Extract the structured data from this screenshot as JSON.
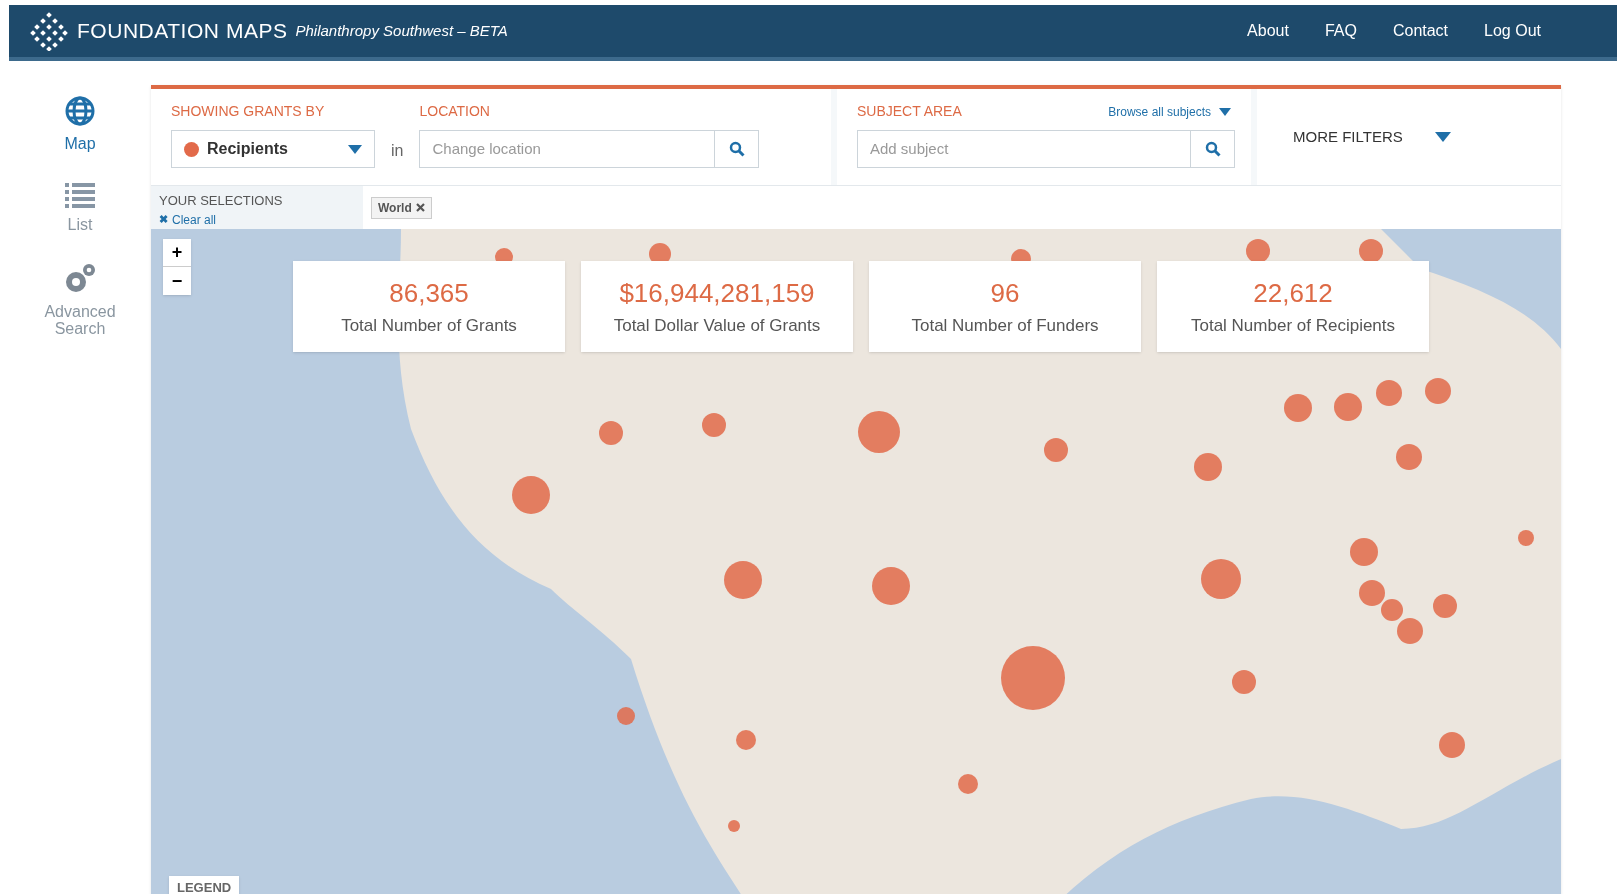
{
  "header": {
    "logo": "FOUNDATION MAPS",
    "subtitle": "Philanthropy Southwest – BETA",
    "nav": [
      "About",
      "FAQ",
      "Contact",
      "Log Out"
    ]
  },
  "sidebar": [
    {
      "kind": "map",
      "label": "Map",
      "selected": true
    },
    {
      "kind": "list",
      "label": "List",
      "selected": false
    },
    {
      "kind": "search",
      "label": "Advanced Search",
      "selected": false
    }
  ],
  "filters": {
    "showing_label": "SHOWING GRANTS BY",
    "showing_value": "Recipients",
    "connector": "in",
    "location_label": "LOCATION",
    "location_placeholder": "Change location",
    "subject_label": "SUBJECT AREA",
    "browse_link": "Browse all subjects",
    "subject_placeholder": "Add subject",
    "more_filters": "MORE FILTERS"
  },
  "selections": {
    "label": "YOUR SELECTIONS",
    "clear_icon": "✖",
    "clear": "Clear all",
    "tags": [
      "World"
    ]
  },
  "map": {
    "zoom_in": "+",
    "zoom_out": "−",
    "legend": "LEGEND"
  },
  "stats": [
    {
      "value": "86,365",
      "label": "Total Number of Grants"
    },
    {
      "value": "$16,944,281,159",
      "label": "Total Dollar Value of Grants"
    },
    {
      "value": "96",
      "label": "Total Number of Funders"
    },
    {
      "value": "22,612",
      "label": "Total Number of Recipients"
    }
  ]
}
